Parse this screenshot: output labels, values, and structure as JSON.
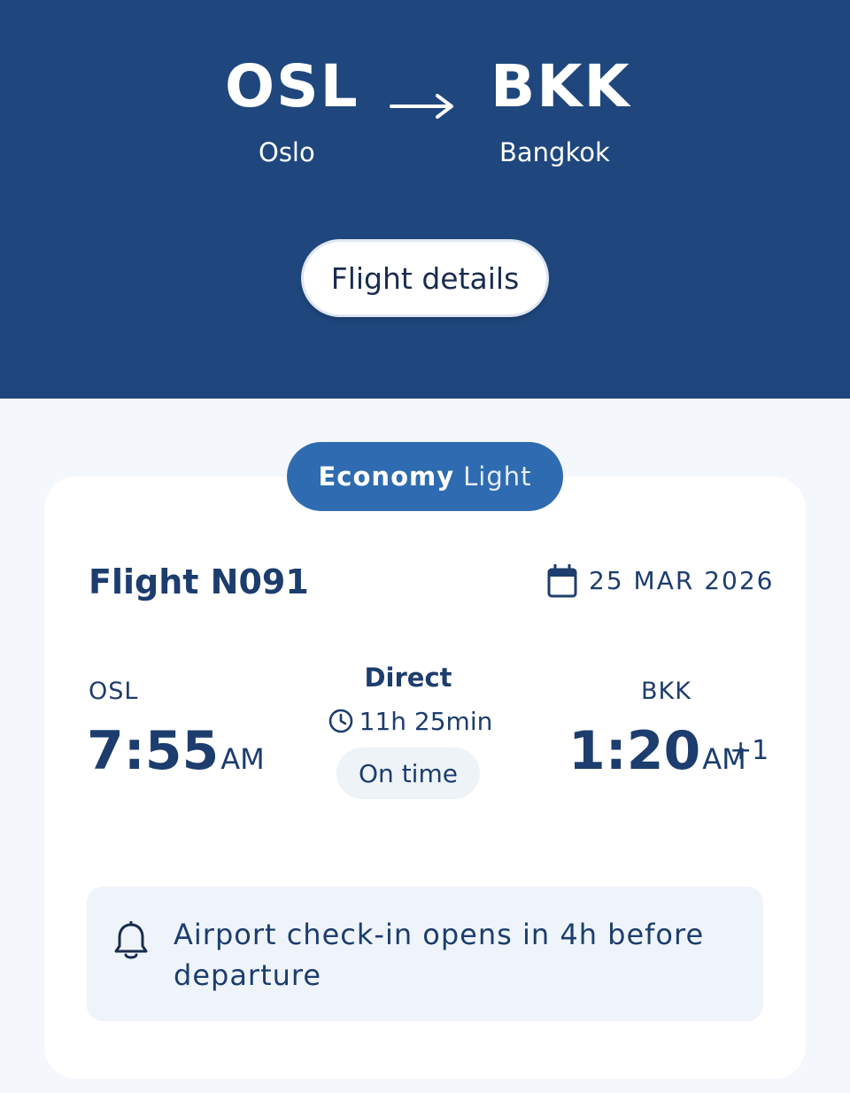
{
  "route": {
    "origin_code": "OSL",
    "origin_city": "Oslo",
    "destination_code": "BKK",
    "destination_city": "Bangkok"
  },
  "actions": {
    "flight_details_label": "Flight details"
  },
  "fare": {
    "cabin": "Economy",
    "variant": "Light"
  },
  "flight": {
    "number_label": "Flight N091",
    "date": "25 MAR 2026",
    "departure": {
      "airport": "OSL",
      "time": "7:55",
      "ampm": "AM"
    },
    "arrival": {
      "airport": "BKK",
      "time": "1:20",
      "ampm": "AM",
      "day_offset": "+1"
    },
    "stops_label": "Direct",
    "duration": "11h 25min",
    "status": "On time"
  },
  "notice": {
    "text": "Airport check-in opens in 4h before departure"
  },
  "icons": [
    "arrow-right-icon",
    "calendar-icon",
    "clock-icon",
    "bell-icon"
  ],
  "colors": {
    "header_bg": "#1f477e",
    "pill_bg": "#2f6bb0",
    "text_primary": "#1c3d6e"
  }
}
